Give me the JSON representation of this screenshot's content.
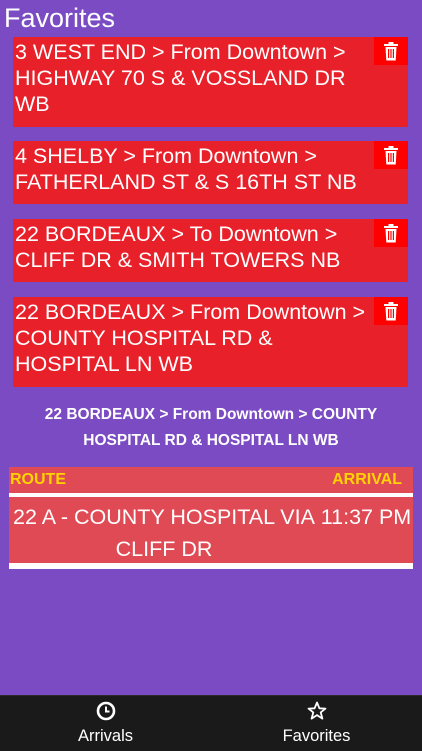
{
  "header": {
    "title": "Favorites"
  },
  "favorites": [
    {
      "label": "3 WEST END > From Downtown > HIGHWAY 70 S & VOSSLAND DR WB"
    },
    {
      "label": "4 SHELBY > From Downtown > FATHERLAND ST & S 16TH ST NB"
    },
    {
      "label": "22 BORDEAUX > To Downtown > CLIFF DR & SMITH TOWERS NB"
    },
    {
      "label": "22 BORDEAUX > From Downtown > COUNTY HOSPITAL RD & HOSPITAL LN WB"
    }
  ],
  "selected_stop": "22 BORDEAUX > From Downtown > COUNTY HOSPITAL RD & HOSPITAL LN WB",
  "arrivals_table": {
    "headers": {
      "route": "ROUTE",
      "arrival": "ARRIVAL"
    },
    "rows": [
      {
        "route": "22 A - COUNTY HOSPITAL VIA CLIFF DR",
        "arrival": "11:37 PM"
      }
    ]
  },
  "tab_bar": {
    "tabs": [
      {
        "label": "Arrivals",
        "icon": "clock-icon"
      },
      {
        "label": "Favorites",
        "icon": "star-icon"
      }
    ]
  },
  "colors": {
    "background": "#7b4bc4",
    "card": "#e8202a",
    "delete": "#ff0000",
    "table": "#e04a55",
    "header_text": "#ffd400",
    "tab_bar": "#1a1a1a"
  }
}
